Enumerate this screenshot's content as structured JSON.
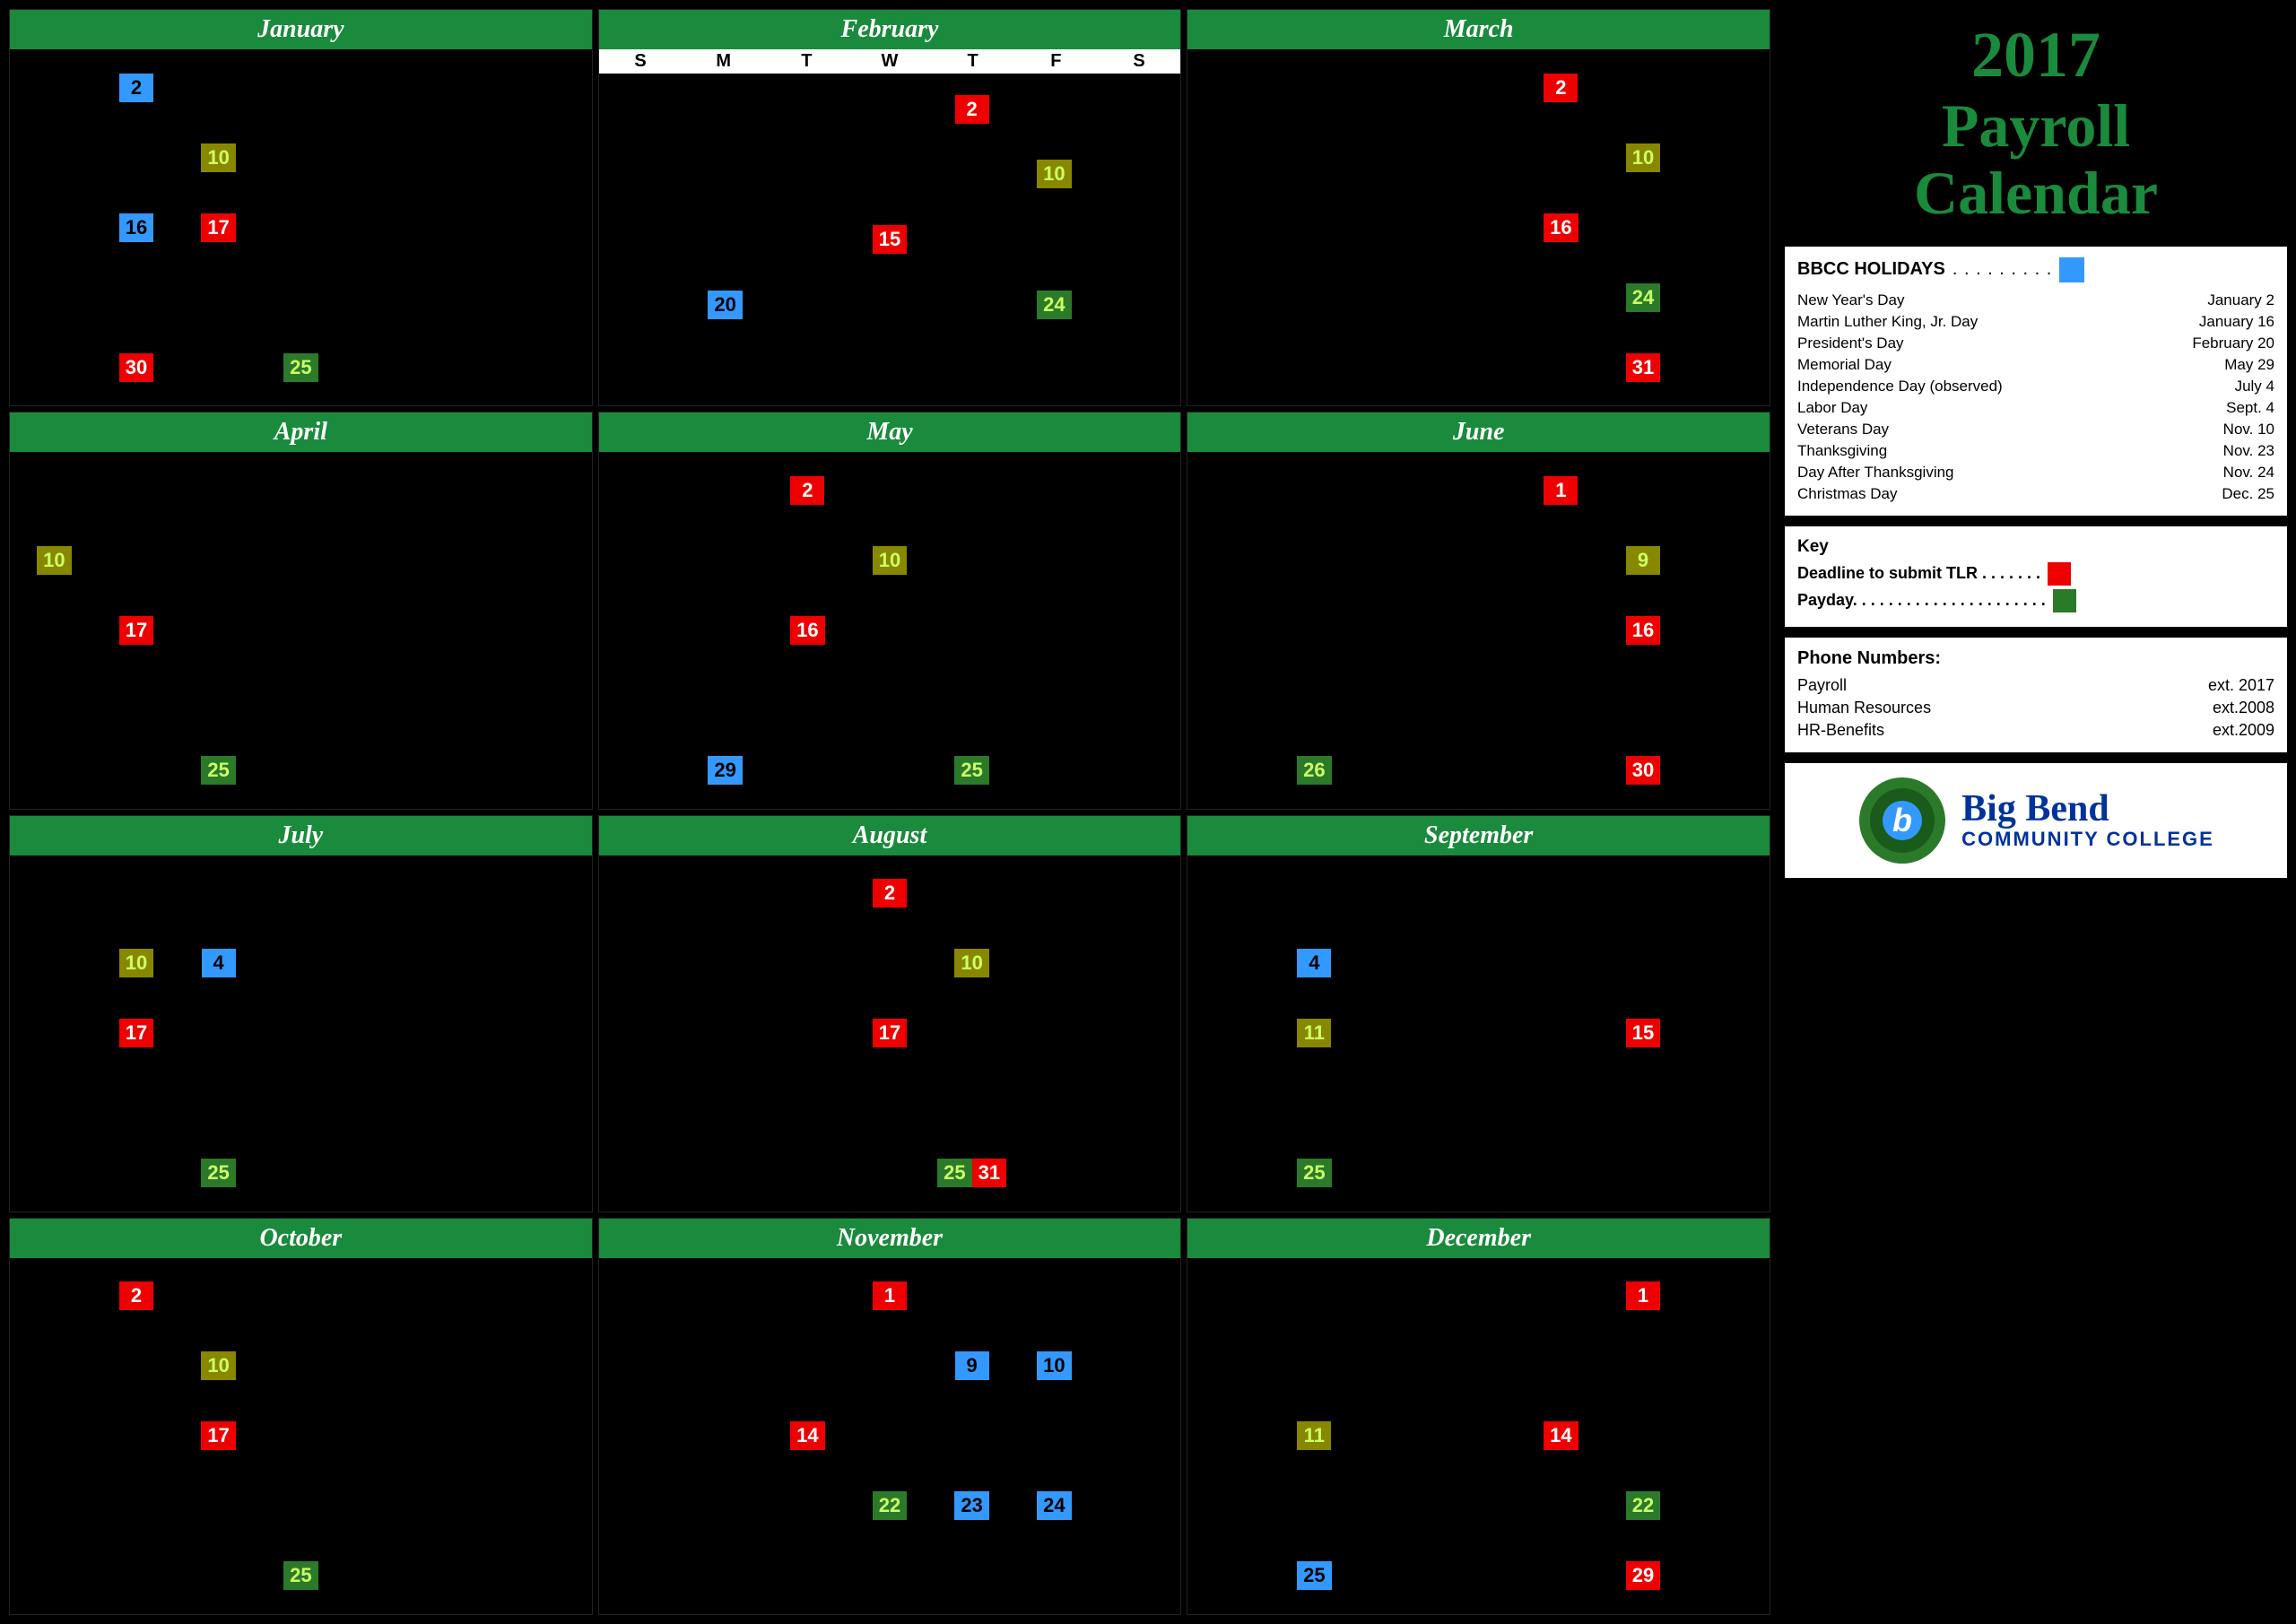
{
  "title": {
    "year": "2017",
    "line1": "Payroll",
    "line2": "Calendar"
  },
  "months": [
    {
      "name": "January",
      "showDayHeaders": false,
      "dates": [
        {
          "day": 30,
          "col": 2,
          "type": "red"
        },
        {
          "day": 2,
          "col": 2,
          "type": "blue"
        },
        {
          "day": 10,
          "col": 3,
          "type": "olive"
        },
        {
          "day": 16,
          "col": 2,
          "type": "blue"
        },
        {
          "day": 17,
          "col": 3,
          "type": "red"
        },
        {
          "day": 25,
          "col": 4,
          "type": "green"
        }
      ]
    },
    {
      "name": "February",
      "showDayHeaders": true,
      "dates": [
        {
          "day": 2,
          "col": 5,
          "type": "red"
        },
        {
          "day": 10,
          "col": 6,
          "type": "olive"
        },
        {
          "day": 15,
          "col": 4,
          "type": "red"
        },
        {
          "day": 20,
          "col": 2,
          "type": "blue"
        },
        {
          "day": 24,
          "col": 6,
          "type": "green"
        }
      ]
    },
    {
      "name": "March",
      "showDayHeaders": false,
      "dates": [
        {
          "day": 2,
          "col": 5,
          "type": "red"
        },
        {
          "day": 10,
          "col": 6,
          "type": "olive"
        },
        {
          "day": 16,
          "col": 5,
          "type": "red"
        },
        {
          "day": 24,
          "col": 6,
          "type": "green"
        },
        {
          "day": 31,
          "col": 6,
          "type": "red"
        }
      ]
    },
    {
      "name": "April",
      "showDayHeaders": false,
      "dates": [
        {
          "day": 10,
          "col": 1,
          "type": "olive"
        },
        {
          "day": 17,
          "col": 2,
          "type": "red"
        },
        {
          "day": 25,
          "col": 3,
          "type": "green"
        }
      ]
    },
    {
      "name": "May",
      "showDayHeaders": false,
      "dates": [
        {
          "day": 2,
          "col": 3,
          "type": "red"
        },
        {
          "day": 10,
          "col": 4,
          "type": "olive"
        },
        {
          "day": 16,
          "col": 3,
          "type": "red"
        },
        {
          "day": 25,
          "col": 5,
          "type": "green"
        },
        {
          "day": 29,
          "col": 2,
          "type": "blue"
        }
      ]
    },
    {
      "name": "June",
      "showDayHeaders": false,
      "dates": [
        {
          "day": 1,
          "col": 5,
          "type": "red"
        },
        {
          "day": 9,
          "col": 6,
          "type": "olive"
        },
        {
          "day": 16,
          "col": 6,
          "type": "red"
        },
        {
          "day": 26,
          "col": 2,
          "type": "green"
        },
        {
          "day": 30,
          "col": 6,
          "type": "red"
        }
      ]
    },
    {
      "name": "July",
      "showDayHeaders": false,
      "dates": [
        {
          "day": 4,
          "col": 3,
          "type": "blue"
        },
        {
          "day": 10,
          "col": 2,
          "type": "olive"
        },
        {
          "day": 17,
          "col": 2,
          "type": "red"
        },
        {
          "day": 25,
          "col": 3,
          "type": "green"
        }
      ]
    },
    {
      "name": "August",
      "showDayHeaders": false,
      "dates": [
        {
          "day": 2,
          "col": 4,
          "type": "red"
        },
        {
          "day": 10,
          "col": 5,
          "type": "olive"
        },
        {
          "day": 17,
          "col": 4,
          "type": "red"
        },
        {
          "day": 25,
          "col": 5,
          "type": "green"
        },
        {
          "day": 31,
          "col": 5,
          "type": "red"
        }
      ]
    },
    {
      "name": "September",
      "showDayHeaders": false,
      "dates": [
        {
          "day": 4,
          "col": 2,
          "type": "blue"
        },
        {
          "day": 11,
          "col": 2,
          "type": "olive"
        },
        {
          "day": 15,
          "col": 6,
          "type": "red"
        },
        {
          "day": 25,
          "col": 2,
          "type": "green"
        }
      ]
    },
    {
      "name": "October",
      "showDayHeaders": false,
      "dates": [
        {
          "day": 2,
          "col": 2,
          "type": "red"
        },
        {
          "day": 10,
          "col": 3,
          "type": "olive"
        },
        {
          "day": 17,
          "col": 3,
          "type": "red"
        },
        {
          "day": 25,
          "col": 4,
          "type": "green"
        }
      ]
    },
    {
      "name": "November",
      "showDayHeaders": false,
      "dates": [
        {
          "day": 1,
          "col": 4,
          "type": "red"
        },
        {
          "day": 9,
          "col": 5,
          "type": "blue"
        },
        {
          "day": 10,
          "col": 6,
          "type": "blue"
        },
        {
          "day": 14,
          "col": 3,
          "type": "red"
        },
        {
          "day": 22,
          "col": 4,
          "type": "green"
        },
        {
          "day": 23,
          "col": 5,
          "type": "blue"
        },
        {
          "day": 24,
          "col": 6,
          "type": "blue"
        }
      ]
    },
    {
      "name": "December",
      "showDayHeaders": false,
      "dates": [
        {
          "day": 1,
          "col": 6,
          "type": "red"
        },
        {
          "day": 11,
          "col": 2,
          "type": "olive"
        },
        {
          "day": 14,
          "col": 5,
          "type": "red"
        },
        {
          "day": 22,
          "col": 6,
          "type": "green"
        },
        {
          "day": 25,
          "col": 2,
          "type": "blue"
        },
        {
          "day": 29,
          "col": 6,
          "type": "red"
        }
      ]
    }
  ],
  "holidays": {
    "title": "BBCC HOLIDAYS",
    "items": [
      {
        "name": "New Year's Day",
        "date": "January 2"
      },
      {
        "name": "Martin Luther King, Jr. Day",
        "date": "January 16"
      },
      {
        "name": "President's Day",
        "date": "February 20"
      },
      {
        "name": "Memorial Day",
        "date": "May 29"
      },
      {
        "name": "Independence Day (observed)",
        "date": "July 4"
      },
      {
        "name": "Labor Day",
        "date": "Sept. 4"
      },
      {
        "name": "Veterans Day",
        "date": "Nov. 10"
      },
      {
        "name": "Thanksgiving",
        "date": "Nov. 23"
      },
      {
        "name": "Day After Thanksgiving",
        "date": "Nov. 24"
      },
      {
        "name": "Christmas Day",
        "date": "Dec. 25"
      }
    ]
  },
  "key": {
    "title": "Key",
    "deadline_label": "Deadline to submit TLR . . . . . . .",
    "payday_label": "Payday. . . . . . . . . . . . . . . . . . . . . ."
  },
  "phone": {
    "title": "Phone Numbers:",
    "items": [
      {
        "label": "Payroll",
        "value": "ext. 2017"
      },
      {
        "label": "Human Resources",
        "value": "ext.2008"
      },
      {
        "label": "HR-Benefits",
        "value": "ext.2009"
      }
    ]
  },
  "logo": {
    "letter": "b",
    "name_line1": "Big Bend",
    "name_line2": "COMMUNITY COLLEGE"
  },
  "day_headers": [
    "S",
    "M",
    "T",
    "W",
    "T",
    "F",
    "S"
  ]
}
